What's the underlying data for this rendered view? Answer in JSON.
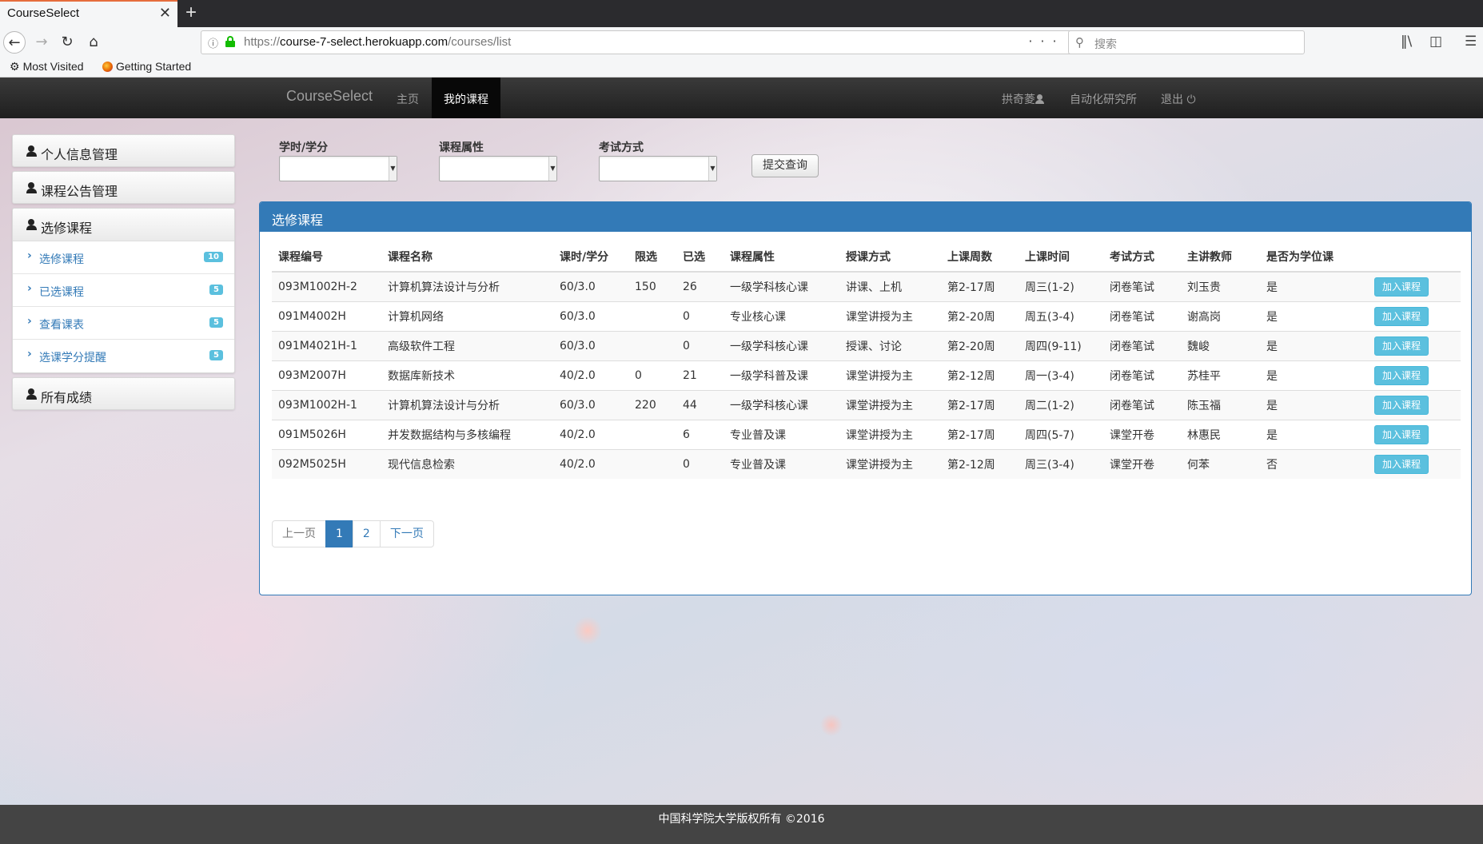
{
  "browser": {
    "tab_title": "CourseSelect",
    "tab_close": "✕",
    "new_tab": "+",
    "url_proto": "https://",
    "url_host": "course-7-select.herokuapp.com",
    "url_path": "/courses/list",
    "search_placeholder": "搜索",
    "bookmarks": [
      "Most Visited",
      "Getting Started"
    ]
  },
  "site": {
    "brand": "CourseSelect",
    "nav": {
      "home": "主页",
      "my_courses": "我的课程"
    },
    "user": "拱奇菱",
    "institute": "自动化研究所",
    "logout": "退出"
  },
  "sidebar": {
    "personal": "个人信息管理",
    "notice": "课程公告管理",
    "select": "选修课程",
    "items": [
      {
        "label": "选修课程",
        "badge": "10"
      },
      {
        "label": "已选课程",
        "badge": "5"
      },
      {
        "label": "查看课表",
        "badge": "5"
      },
      {
        "label": "选课学分提醒",
        "badge": "5"
      }
    ],
    "grades": "所有成绩"
  },
  "filters": {
    "hours_label": "学时/学分",
    "attr_label": "课程属性",
    "exam_label": "考试方式",
    "submit": "提交查询"
  },
  "panel": {
    "title": "选修课程",
    "headers": [
      "课程编号",
      "课程名称",
      "课时/学分",
      "限选",
      "已选",
      "课程属性",
      "授课方式",
      "上课周数",
      "上课时间",
      "考试方式",
      "主讲教师",
      "是否为学位课",
      ""
    ],
    "add_label": "加入课程",
    "rows": [
      [
        "093M1002H-2",
        "计算机算法设计与分析",
        "60/3.0",
        "150",
        "26",
        "一级学科核心课",
        "讲课、上机",
        "第2-17周",
        "周三(1-2)",
        "闭卷笔试",
        "刘玉贵",
        "是"
      ],
      [
        "091M4002H",
        "计算机网络",
        "60/3.0",
        "",
        "0",
        "专业核心课",
        "课堂讲授为主",
        "第2-20周",
        "周五(3-4)",
        "闭卷笔试",
        "谢高岗",
        "是"
      ],
      [
        "091M4021H-1",
        "高级软件工程",
        "60/3.0",
        "",
        "0",
        "一级学科核心课",
        "授课、讨论",
        "第2-20周",
        "周四(9-11)",
        "闭卷笔试",
        "魏峻",
        "是"
      ],
      [
        "093M2007H",
        "数据库新技术",
        "40/2.0",
        "0",
        "21",
        "一级学科普及课",
        "课堂讲授为主",
        "第2-12周",
        "周一(3-4)",
        "闭卷笔试",
        "苏桂平",
        "是"
      ],
      [
        "093M1002H-1",
        "计算机算法设计与分析",
        "60/3.0",
        "220",
        "44",
        "一级学科核心课",
        "课堂讲授为主",
        "第2-17周",
        "周二(1-2)",
        "闭卷笔试",
        "陈玉福",
        "是"
      ],
      [
        "091M5026H",
        "并发数据结构与多核编程",
        "40/2.0",
        "",
        "6",
        "专业普及课",
        "课堂讲授为主",
        "第2-17周",
        "周四(5-7)",
        "课堂开卷",
        "林惠民",
        "是"
      ],
      [
        "092M5025H",
        "现代信息检索",
        "40/2.0",
        "",
        "0",
        "专业普及课",
        "课堂讲授为主",
        "第2-12周",
        "周三(3-4)",
        "课堂开卷",
        "何苯",
        "否"
      ]
    ],
    "pagination": {
      "prev": "上一页",
      "pages": [
        "1",
        "2"
      ],
      "next": "下一页",
      "current": "1"
    }
  },
  "footer": "中国科学院大学版权所有 ©2016"
}
